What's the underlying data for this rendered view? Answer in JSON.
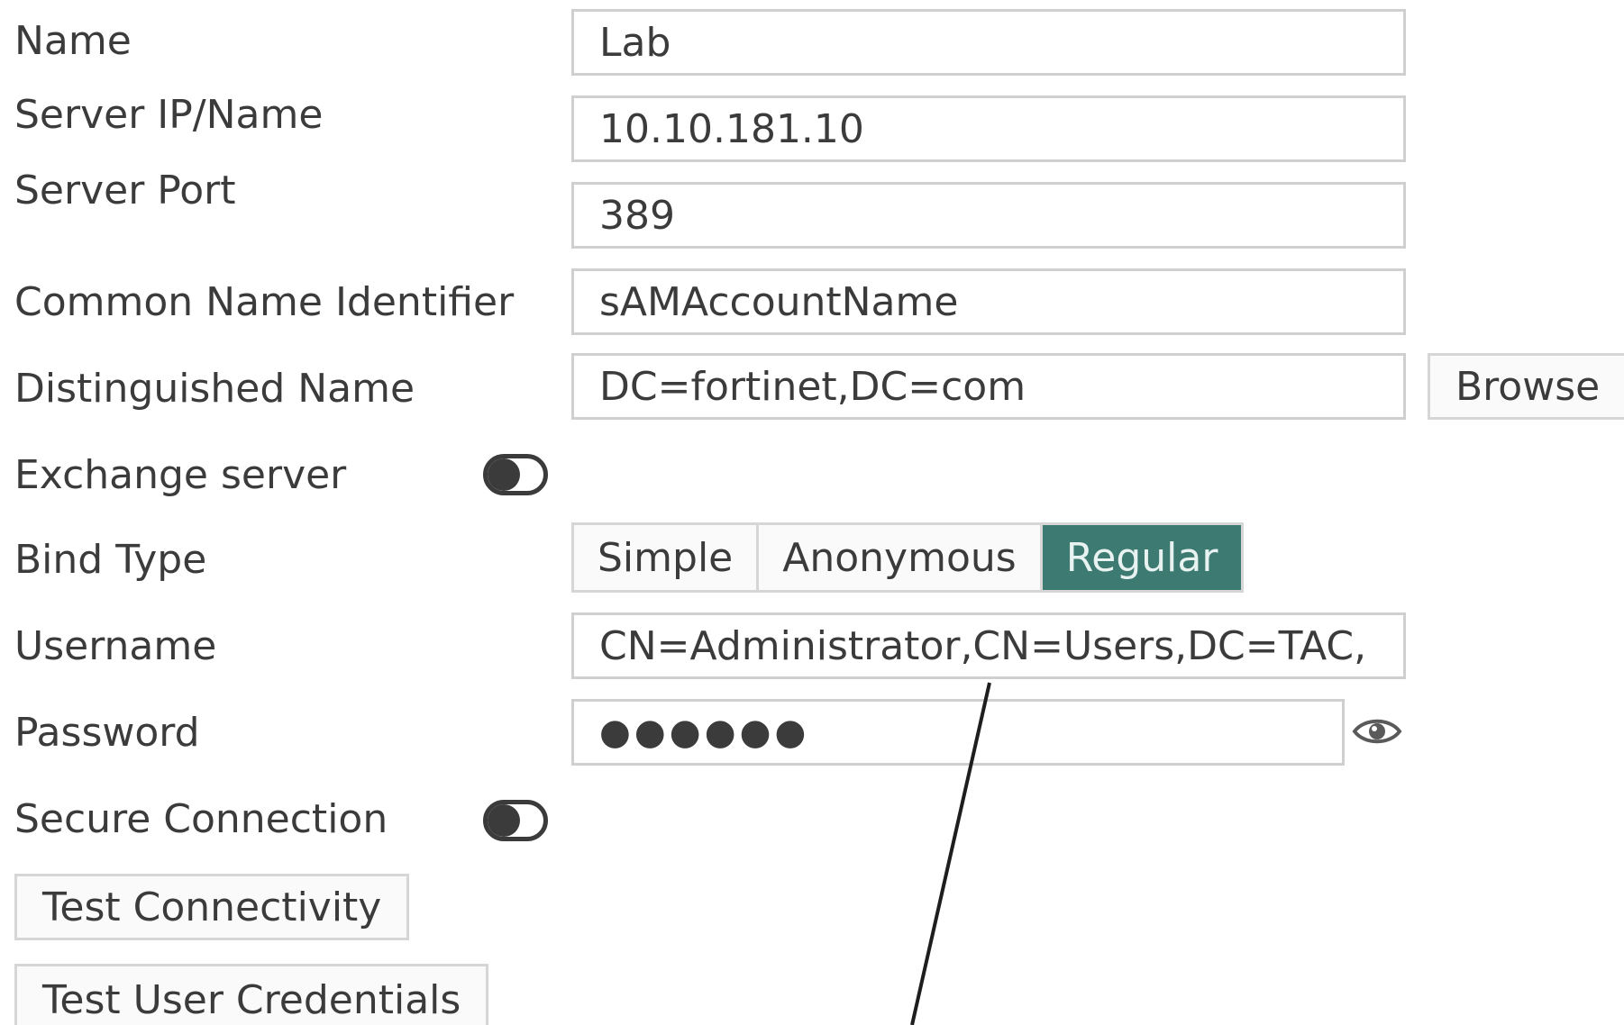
{
  "form": {
    "name": {
      "label": "Name",
      "value": "Lab"
    },
    "server_ip": {
      "label": "Server IP/Name",
      "value": "10.10.181.10"
    },
    "server_port": {
      "label": "Server Port",
      "value": "389"
    },
    "common_name": {
      "label": "Common Name Identifier",
      "value": "sAMAccountName"
    },
    "distinguished_name": {
      "label": "Distinguished Name",
      "value": "DC=fortinet,DC=com",
      "browse_label": "Browse"
    },
    "exchange_server": {
      "label": "Exchange server",
      "enabled": false
    },
    "bind_type": {
      "label": "Bind Type",
      "options": [
        "Simple",
        "Anonymous",
        "Regular"
      ],
      "selected": "Regular"
    },
    "username": {
      "label": "Username",
      "value": "CN=Administrator,CN=Users,DC=TAC,"
    },
    "password": {
      "label": "Password",
      "masked_value": "●●●●●●"
    },
    "secure_connection": {
      "label": "Secure Connection",
      "enabled": false
    }
  },
  "buttons": {
    "test_connectivity": "Test Connectivity",
    "test_user_credentials": "Test User Credentials"
  },
  "icons": {
    "password_reveal": "eye-icon"
  },
  "colors": {
    "active_segment": "#3d7a72",
    "field_border": "#cfcfcf",
    "text": "#3b3b3b"
  }
}
